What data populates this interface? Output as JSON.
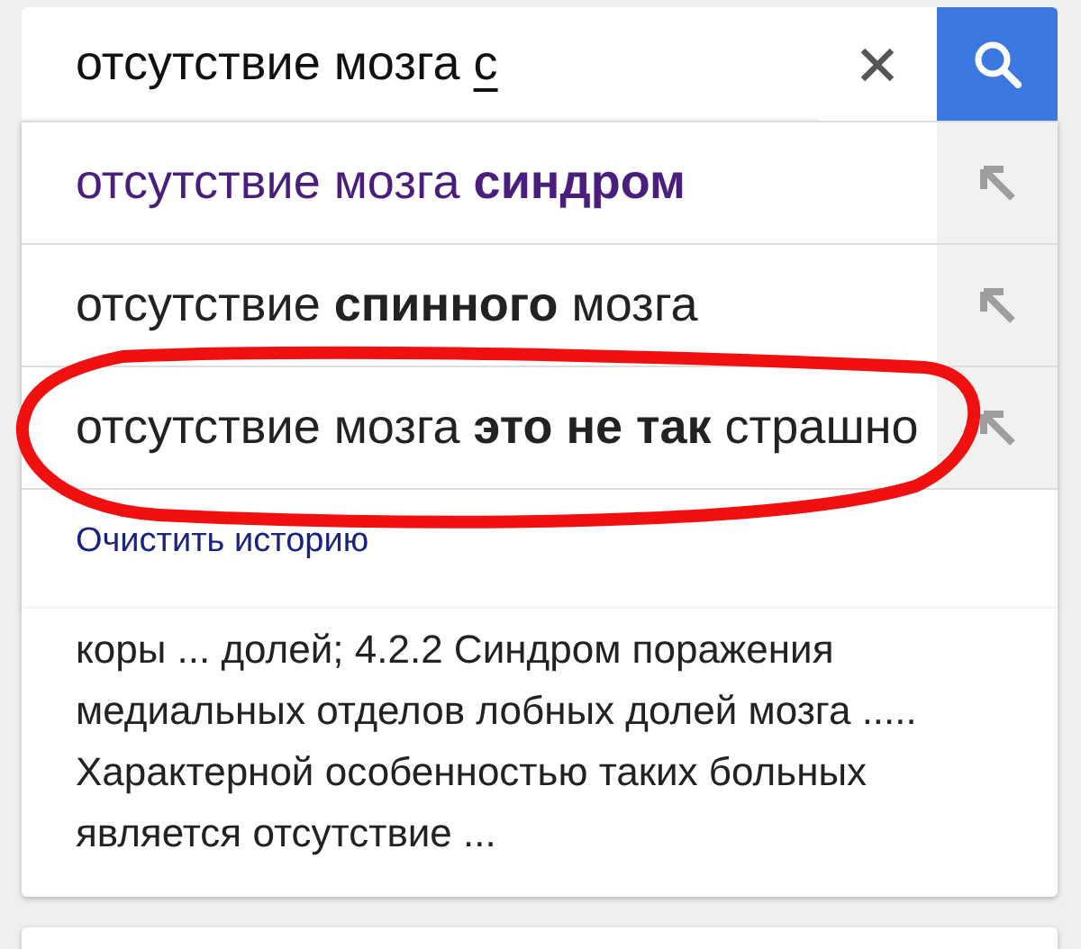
{
  "search": {
    "value": "отсутствие мозга ",
    "composing": "с"
  },
  "suggestions": [
    {
      "text": "отсутствие мозга **синдром**",
      "visited": true,
      "circled": false
    },
    {
      "text": "отсутствие **спинного** мозга",
      "visited": false,
      "circled": false
    },
    {
      "text": "отсутствие мозга **это не так** страшно",
      "visited": false,
      "circled": true
    }
  ],
  "clear_history": "Очистить историю",
  "result": {
    "snippet": "коры ... долей; 4.2.2 Синдром поражения медиальных отделов лобных долей мозга ..... Характерной особенностью таких больных является отсутствие ..."
  }
}
